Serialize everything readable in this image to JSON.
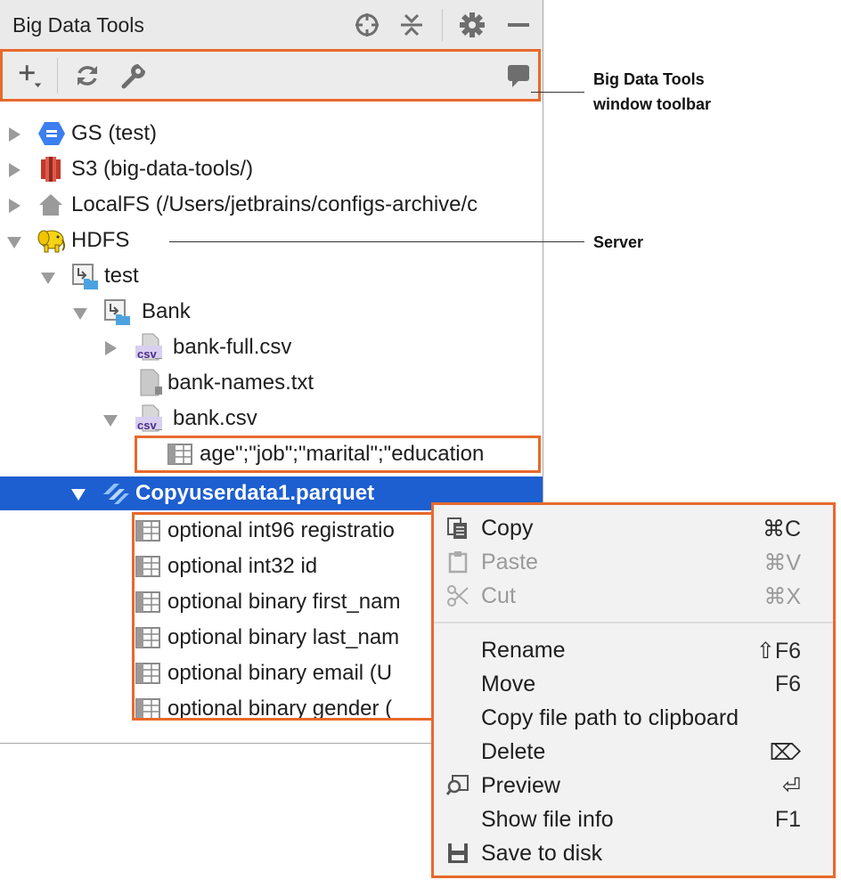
{
  "window": {
    "title": "Big Data Tools"
  },
  "title_icons": [
    "crosshair-icon",
    "collapse-icon",
    "gear-icon",
    "minimize-icon"
  ],
  "toolbar": {
    "icons": [
      "add-icon",
      "refresh-icon",
      "wrench-icon",
      "comment-icon"
    ]
  },
  "callouts": {
    "toolbar_line1": "Big Data Tools",
    "toolbar_line2": "window toolbar",
    "server": "Server"
  },
  "tree": {
    "gs": "GS (test)",
    "s3": "S3 (big-data-tools/)",
    "localfs": "LocalFS (/Users/jetbrains/configs-archive/c",
    "hdfs": "HDFS",
    "test": "test",
    "bank": "Bank",
    "bank_full": "bank-full.csv",
    "bank_names": "bank-names.txt",
    "bank_csv": "bank.csv",
    "bank_csv_row": "age\";\"job\";\"marital\";\"education",
    "parquet": "Copyuserdata1.parquet",
    "fields": [
      "optional int96 registratio",
      "optional int32 id",
      "optional binary first_nam",
      "optional binary last_nam",
      "optional binary email (U",
      "optional binary gender ("
    ],
    "csv_badge": "csv"
  },
  "context_menu": {
    "items": [
      {
        "label": "Copy",
        "shortcut": "⌘C"
      },
      {
        "label": "Paste",
        "shortcut": "⌘V"
      },
      {
        "label": "Cut",
        "shortcut": "⌘X"
      },
      {
        "label": "Rename",
        "shortcut": "⇧F6"
      },
      {
        "label": "Move",
        "shortcut": "F6"
      },
      {
        "label": "Copy file path to clipboard",
        "shortcut": ""
      },
      {
        "label": "Delete",
        "shortcut": "⌦"
      },
      {
        "label": "Preview",
        "shortcut": "⏎"
      },
      {
        "label": "Show file info",
        "shortcut": "F1"
      },
      {
        "label": "Save to disk",
        "shortcut": ""
      }
    ]
  },
  "colors": {
    "accent_outline": "#e8692c",
    "selection": "#1d5fd0"
  }
}
